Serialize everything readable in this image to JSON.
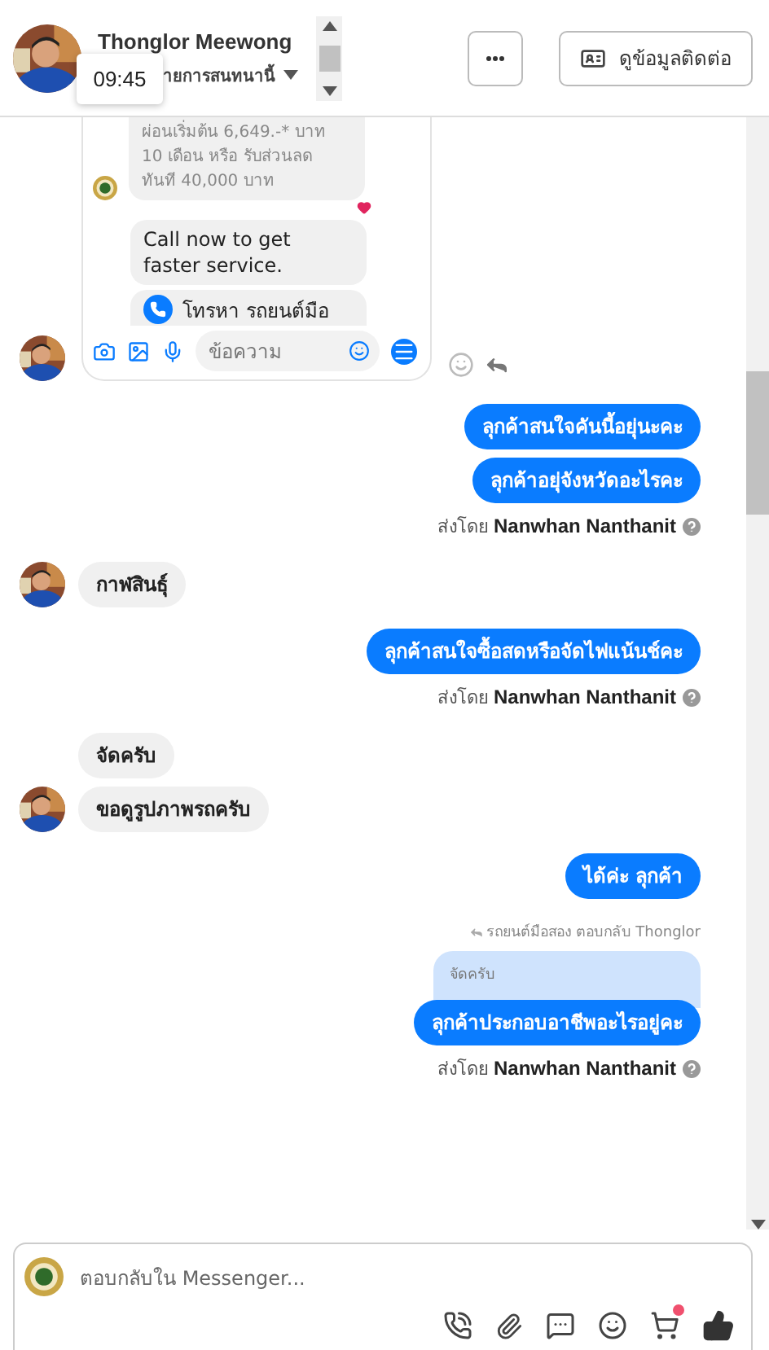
{
  "header": {
    "name": "Thonglor Meewong",
    "subtitle": "ายการสนทนานี้",
    "tooltip": "09:45",
    "contact_button": "ดูข้อมูลติดต่อ"
  },
  "shared_card": {
    "offer_lines": [
      "ผ่อนเริ่มต้น 6,649.-* บาท",
      "10 เดือน หรือ รับส่วนลด",
      "ทันที 40,000 บาท"
    ],
    "reacted": true,
    "cta_text": "Call now to get faster service.",
    "call_button": "โทรหา รถยนต์มือ",
    "composer_placeholder": "ข้อความ"
  },
  "messages": [
    {
      "kind": "outgoing",
      "text": "ลุกค้าสนใจคันนี้อยุ่นะคะ"
    },
    {
      "kind": "outgoing",
      "text": "ลุกค้าอยุ่จังหวัดอะไรคะ"
    },
    {
      "kind": "note",
      "prefix": "ส่งโดย",
      "sender": "Nanwhan Nanthanit"
    },
    {
      "kind": "incoming",
      "text": "กาฬสินธุ์",
      "avatar": true
    },
    {
      "kind": "outgoing",
      "text": "ลุกค้าสนใจซื้อสดหรือจัดไฟแน้นช์คะ"
    },
    {
      "kind": "note",
      "prefix": "ส่งโดย",
      "sender": "Nanwhan Nanthanit"
    },
    {
      "kind": "incoming",
      "text": "จัดครับ",
      "avatar": false
    },
    {
      "kind": "incoming",
      "text": "ขอดูรูปภาพรถครับ",
      "avatar": true
    },
    {
      "kind": "outgoing",
      "text": "ได้ค่ะ ลุกค้า"
    },
    {
      "kind": "reply",
      "header": "รถยนต์มือสอง ตอบกลับ Thonglor",
      "quoted": "จัดครับ",
      "text": "ลุกค้าประกอบอาชีพอะไรอยู่คะ"
    },
    {
      "kind": "note",
      "prefix": "ส่งโดย",
      "sender": "Nanwhan Nanthanit"
    }
  ],
  "composer": {
    "placeholder": "ตอบกลับใน Messenger...",
    "cart_badge": true
  }
}
